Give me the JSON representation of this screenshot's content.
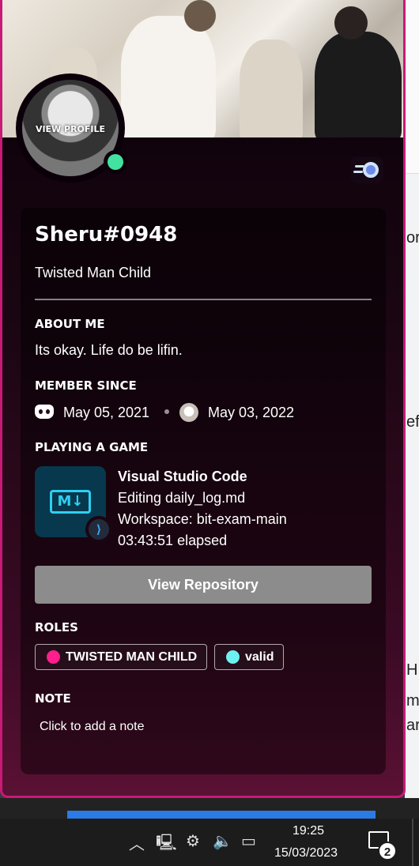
{
  "profile": {
    "avatar_overlay": "VIEW PROFILE",
    "username": "Sheru#0948",
    "custom_status": "Twisted Man Child",
    "status_color": "#43e2a0",
    "accent_border": "#c81a76"
  },
  "about": {
    "header": "ABOUT ME",
    "text": "Its okay. Life do be lifin."
  },
  "member_since": {
    "header": "MEMBER SINCE",
    "discord_date": "May 05, 2021",
    "server_date": "May 03, 2022"
  },
  "activity": {
    "header": "PLAYING A GAME",
    "app_name": "Visual Studio Code",
    "details": "Editing daily_log.md",
    "state": "Workspace: bit-exam-main",
    "elapsed": "03:43:51 elapsed",
    "large_image_label": "M↓",
    "small_image_label": "⟩"
  },
  "button": {
    "label": "View Repository"
  },
  "roles": {
    "header": "ROLES",
    "items": [
      {
        "name": "TWISTED MAN CHILD",
        "color": "#ff1e8e"
      },
      {
        "name": "valid",
        "color": "#6ef0f0"
      }
    ]
  },
  "note": {
    "header": "NOTE",
    "placeholder": "Click to add a note"
  },
  "background_text": {
    "t1": "or",
    "t2": "eff",
    "t3": "H",
    "t4": "my",
    "t5": "ar"
  },
  "taskbar": {
    "time": "19:25",
    "date": "15/03/2023",
    "notification_count": "2",
    "icons": [
      "chevron-up-icon",
      "network-icon",
      "steelseries-icon",
      "volume-icon",
      "battery-icon"
    ]
  }
}
